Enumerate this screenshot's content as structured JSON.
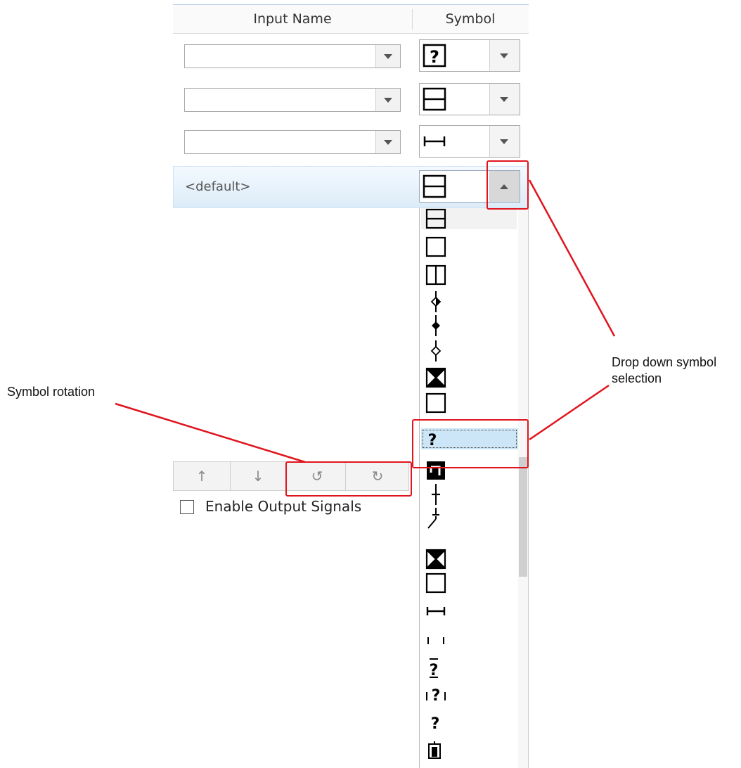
{
  "header": {
    "input_name": "Input Name",
    "symbol": "Symbol"
  },
  "rows": [
    {
      "input_value": "",
      "symbol_icon": "question-box-icon"
    },
    {
      "input_value": "",
      "symbol_icon": "split-box-horizontal-icon"
    },
    {
      "input_value": "",
      "symbol_icon": "h-bar-icon"
    }
  ],
  "selected_row": {
    "label": "<default>",
    "symbol_icon": "split-box-horizontal-icon"
  },
  "dropdown_items": [
    "split-box-horizontal-icon",
    "empty-box-icon",
    "split-box-vertical-icon",
    "diamond-half-line-icon",
    "diamond-filled-line-icon",
    "diamond-open-line-icon",
    "x-box-filled-icon",
    "empty-box-icon",
    "question-mark-icon",
    "breaker-filled-icon",
    "line-tick-icon",
    "switch-open-icon",
    "x-box-filled-icon",
    "empty-box-icon",
    "h-bar-icon",
    "dashed-gap-icon",
    "question-overbar-icon",
    "question-brackets-icon",
    "question-mark-icon",
    "device-icon"
  ],
  "selected_item_index": 8,
  "toolbar": {
    "up": "↑",
    "down": "↓",
    "rotate_ccw": "↺",
    "rotate_cw": "↻"
  },
  "enable_output": {
    "label": "Enable Output Signals",
    "checked": false
  },
  "annotations": {
    "symbol_rotation": "Symbol rotation",
    "dropdown_line1": "Drop down symbol",
    "dropdown_line2": "selection"
  },
  "colors": {
    "callout": "#e0141e",
    "selection": "#cde6f7",
    "header_border": "#bcd2ea"
  }
}
